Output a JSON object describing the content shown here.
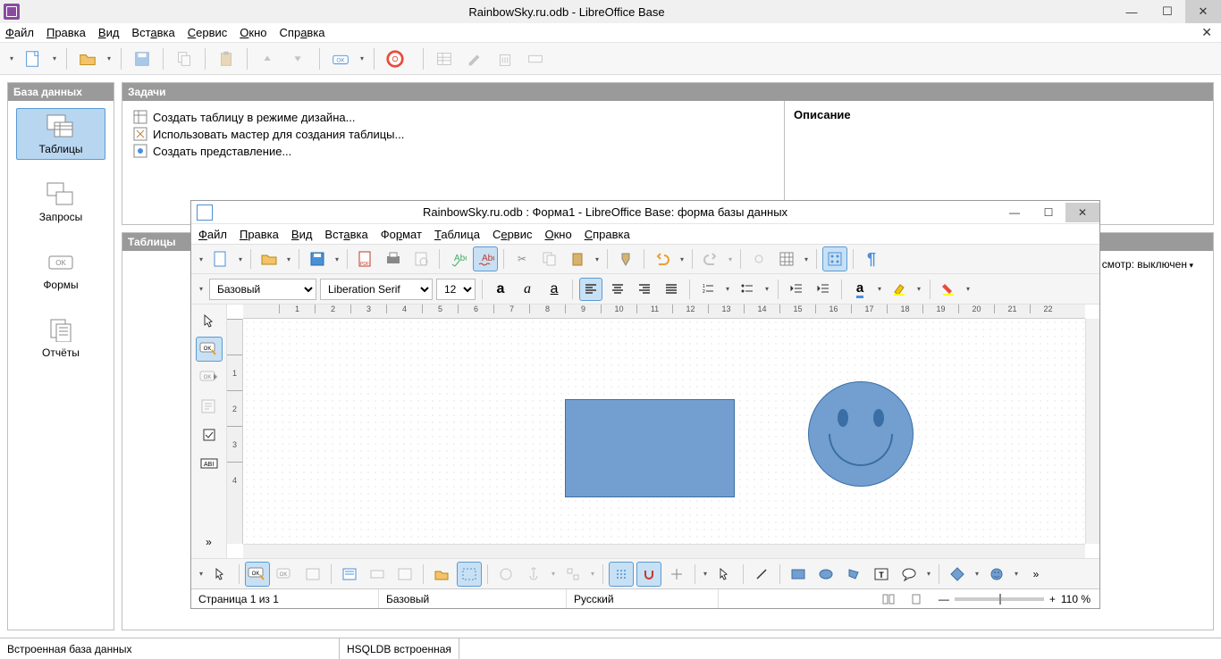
{
  "app": {
    "title": "RainbowSky.ru.odb - LibreOffice Base"
  },
  "menu": [
    "Файл",
    "Правка",
    "Вид",
    "Вставка",
    "Сервис",
    "Окно",
    "Справка"
  ],
  "left_panel": {
    "header": "База данных",
    "items": [
      {
        "label": "Таблицы"
      },
      {
        "label": "Запросы"
      },
      {
        "label": "Формы"
      },
      {
        "label": "Отчёты"
      }
    ]
  },
  "tasks": {
    "header": "Задачи",
    "items": [
      "Создать таблицу в режиме дизайна...",
      "Использовать мастер для создания таблицы...",
      "Создать представление..."
    ],
    "description_label": "Описание"
  },
  "tables_panel": {
    "header": "Таблицы",
    "preview_label": "смотр: выключен"
  },
  "status": {
    "db_type": "Встроенная база данных",
    "engine": "HSQLDB встроенная"
  },
  "form_window": {
    "title": "RainbowSky.ru.odb : Форма1 - LibreOffice Base: форма базы данных",
    "menu": [
      "Файл",
      "Правка",
      "Вид",
      "Вставка",
      "Формат",
      "Таблица",
      "Сервис",
      "Окно",
      "Справка"
    ],
    "style_name": "Базовый",
    "font_name": "Liberation Serif",
    "font_size": "12",
    "ruler_h": [
      1,
      2,
      3,
      4,
      5,
      6,
      7,
      8,
      9,
      10,
      11,
      12,
      13,
      14,
      15,
      16,
      17,
      18,
      19,
      20,
      21,
      22
    ],
    "ruler_v": [
      1,
      2,
      3,
      4
    ],
    "status": {
      "page": "Страница 1 из 1",
      "style": "Базовый",
      "lang": "Русский",
      "zoom": "110 %"
    }
  }
}
